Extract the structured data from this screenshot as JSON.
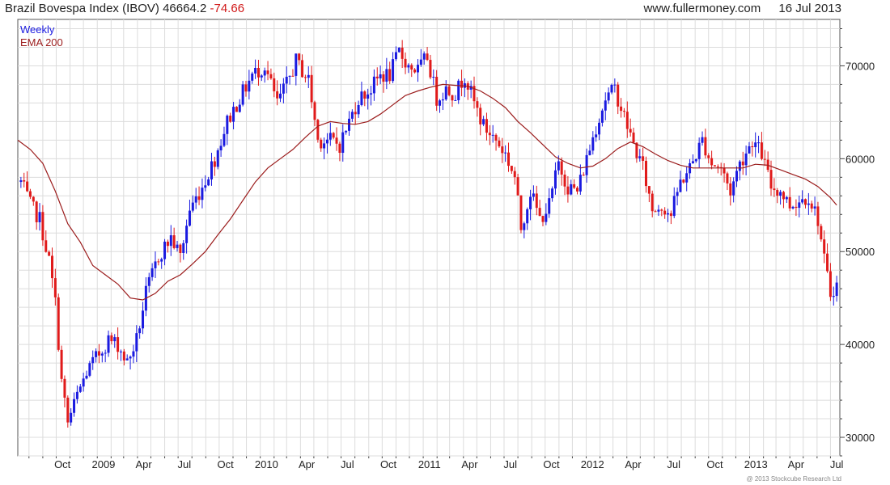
{
  "header": {
    "title": "Brazil Bovespa Index (IBOV)",
    "price": "46664.2",
    "change": "-74.66",
    "site": "www.fullermoney.com",
    "date": "16 Jul 2013"
  },
  "footer": {
    "copyright": "@ 2013 Stockcube Research Ltd"
  },
  "colors": {
    "up": "#1a1ae0",
    "down": "#e01a1a",
    "ema": "#9b1c1c",
    "grid": "#dcdcdc",
    "axis": "#444444"
  },
  "chart_data": {
    "type": "candlestick",
    "frequency": "Weekly",
    "legend": [
      {
        "label": "Weekly",
        "color": "#1a1ae0"
      },
      {
        "label": "EMA 200",
        "color": "#9b1c1c"
      }
    ],
    "legend_position": "top-left",
    "grid": true,
    "x_ticks": [
      "Oct",
      "2009",
      "Apr",
      "Jul",
      "Oct",
      "2010",
      "Apr",
      "Jul",
      "Oct",
      "2011",
      "Apr",
      "Jul",
      "Oct",
      "2012",
      "Apr",
      "Jul",
      "Oct",
      "2013",
      "Apr",
      "Jul"
    ],
    "x_range": [
      "2008-07-07",
      "2013-07-22"
    ],
    "ylim": [
      28000,
      75000
    ],
    "y_ticks": [
      30000,
      40000,
      50000,
      60000,
      70000
    ],
    "y_axis_side": "right",
    "close_path": [
      [
        "2008-07-14",
        57500
      ],
      [
        "2008-08-04",
        55000
      ],
      [
        "2008-08-25",
        53500
      ],
      [
        "2008-09-15",
        49000
      ],
      [
        "2008-09-29",
        44500
      ],
      [
        "2008-10-13",
        36000
      ],
      [
        "2008-10-27",
        31500
      ],
      [
        "2008-11-17",
        34500
      ],
      [
        "2008-12-08",
        37000
      ],
      [
        "2008-12-29",
        38500
      ],
      [
        "2009-01-26",
        40500
      ],
      [
        "2009-02-16",
        40000
      ],
      [
        "2009-03-09",
        38000
      ],
      [
        "2009-03-30",
        40500
      ],
      [
        "2009-04-20",
        45500
      ],
      [
        "2009-05-18",
        49500
      ],
      [
        "2009-06-15",
        51500
      ],
      [
        "2009-07-06",
        49500
      ],
      [
        "2009-07-27",
        54500
      ],
      [
        "2009-08-24",
        57000
      ],
      [
        "2009-09-21",
        60000
      ],
      [
        "2009-10-19",
        64000
      ],
      [
        "2009-11-16",
        66500
      ],
      [
        "2009-12-14",
        69000
      ],
      [
        "2010-01-11",
        70000
      ],
      [
        "2010-02-08",
        66000
      ],
      [
        "2010-03-01",
        68000
      ],
      [
        "2010-03-22",
        70500
      ],
      [
        "2010-04-19",
        68500
      ],
      [
        "2010-05-10",
        62000
      ],
      [
        "2010-06-07",
        62000
      ],
      [
        "2010-06-28",
        61500
      ],
      [
        "2010-07-19",
        64000
      ],
      [
        "2010-08-09",
        66500
      ],
      [
        "2010-09-06",
        67500
      ],
      [
        "2010-09-27",
        69000
      ],
      [
        "2010-10-18",
        69000
      ],
      [
        "2010-11-08",
        71500
      ],
      [
        "2010-11-29",
        70000
      ],
      [
        "2010-12-20",
        69500
      ],
      [
        "2011-01-10",
        71000
      ],
      [
        "2011-01-31",
        66500
      ],
      [
        "2011-02-21",
        67500
      ],
      [
        "2011-03-14",
        67000
      ],
      [
        "2011-04-04",
        69000
      ],
      [
        "2011-04-25",
        66000
      ],
      [
        "2011-05-16",
        63500
      ],
      [
        "2011-06-13",
        62000
      ],
      [
        "2011-07-04",
        60500
      ],
      [
        "2011-07-25",
        58000
      ],
      [
        "2011-08-08",
        52500
      ],
      [
        "2011-08-29",
        56500
      ],
      [
        "2011-09-19",
        53500
      ],
      [
        "2011-10-10",
        55000
      ],
      [
        "2011-10-31",
        59500
      ],
      [
        "2011-11-21",
        57000
      ],
      [
        "2011-12-12",
        56500
      ],
      [
        "2012-01-02",
        60000
      ],
      [
        "2012-01-23",
        63500
      ],
      [
        "2012-02-13",
        66500
      ],
      [
        "2012-03-05",
        67500
      ],
      [
        "2012-03-26",
        64500
      ],
      [
        "2012-04-16",
        61500
      ],
      [
        "2012-05-07",
        59000
      ],
      [
        "2012-05-28",
        54500
      ],
      [
        "2012-06-18",
        55000
      ],
      [
        "2012-07-09",
        54000
      ],
      [
        "2012-07-30",
        57500
      ],
      [
        "2012-08-20",
        59000
      ],
      [
        "2012-09-17",
        62000
      ],
      [
        "2012-10-08",
        59500
      ],
      [
        "2012-10-29",
        59000
      ],
      [
        "2012-11-19",
        56500
      ],
      [
        "2012-12-10",
        59500
      ],
      [
        "2013-01-07",
        62000
      ],
      [
        "2013-01-28",
        60500
      ],
      [
        "2013-02-18",
        57000
      ],
      [
        "2013-03-11",
        56500
      ],
      [
        "2013-04-01",
        55000
      ],
      [
        "2013-04-22",
        55500
      ],
      [
        "2013-05-13",
        56000
      ],
      [
        "2013-06-03",
        53500
      ],
      [
        "2013-06-17",
        49000
      ],
      [
        "2013-07-01",
        45500
      ],
      [
        "2013-07-15",
        46664
      ]
    ],
    "ema_200": [
      [
        "2008-07-07",
        62000
      ],
      [
        "2008-08-04",
        61000
      ],
      [
        "2008-09-01",
        59500
      ],
      [
        "2008-09-29",
        56500
      ],
      [
        "2008-10-27",
        53000
      ],
      [
        "2008-11-24",
        51000
      ],
      [
        "2008-12-22",
        48500
      ],
      [
        "2009-01-19",
        47500
      ],
      [
        "2009-02-16",
        46500
      ],
      [
        "2009-03-16",
        45000
      ],
      [
        "2009-04-13",
        44800
      ],
      [
        "2009-05-11",
        45500
      ],
      [
        "2009-06-08",
        46800
      ],
      [
        "2009-07-06",
        47500
      ],
      [
        "2009-08-03",
        48700
      ],
      [
        "2009-08-31",
        50000
      ],
      [
        "2009-09-28",
        51800
      ],
      [
        "2009-10-26",
        53500
      ],
      [
        "2009-11-23",
        55500
      ],
      [
        "2009-12-21",
        57500
      ],
      [
        "2010-01-18",
        59000
      ],
      [
        "2010-02-15",
        60000
      ],
      [
        "2010-03-15",
        61000
      ],
      [
        "2010-04-12",
        62300
      ],
      [
        "2010-05-10",
        63500
      ],
      [
        "2010-06-07",
        64000
      ],
      [
        "2010-07-05",
        63800
      ],
      [
        "2010-08-02",
        63700
      ],
      [
        "2010-08-30",
        64000
      ],
      [
        "2010-09-27",
        64800
      ],
      [
        "2010-10-25",
        65800
      ],
      [
        "2010-11-22",
        66800
      ],
      [
        "2010-12-20",
        67300
      ],
      [
        "2011-01-17",
        67700
      ],
      [
        "2011-02-14",
        68000
      ],
      [
        "2011-03-14",
        67900
      ],
      [
        "2011-04-11",
        67800
      ],
      [
        "2011-05-09",
        67300
      ],
      [
        "2011-06-06",
        66500
      ],
      [
        "2011-07-04",
        65500
      ],
      [
        "2011-08-01",
        64000
      ],
      [
        "2011-08-29",
        62800
      ],
      [
        "2011-09-26",
        61500
      ],
      [
        "2011-10-24",
        60200
      ],
      [
        "2011-11-21",
        59500
      ],
      [
        "2011-12-19",
        59000
      ],
      [
        "2012-01-16",
        59200
      ],
      [
        "2012-02-13",
        60000
      ],
      [
        "2012-03-12",
        61100
      ],
      [
        "2012-04-09",
        61800
      ],
      [
        "2012-05-07",
        61300
      ],
      [
        "2012-06-04",
        60500
      ],
      [
        "2012-07-02",
        59800
      ],
      [
        "2012-07-30",
        59300
      ],
      [
        "2012-08-27",
        59000
      ],
      [
        "2012-09-24",
        59000
      ],
      [
        "2012-10-22",
        59000
      ],
      [
        "2012-11-19",
        59000
      ],
      [
        "2012-12-17",
        59000
      ],
      [
        "2013-01-14",
        59400
      ],
      [
        "2013-02-11",
        59300
      ],
      [
        "2013-03-11",
        58800
      ],
      [
        "2013-04-08",
        58300
      ],
      [
        "2013-05-06",
        57800
      ],
      [
        "2013-06-03",
        57000
      ],
      [
        "2013-07-01",
        55800
      ],
      [
        "2013-07-15",
        55000
      ]
    ],
    "last_close": 46664.2
  }
}
